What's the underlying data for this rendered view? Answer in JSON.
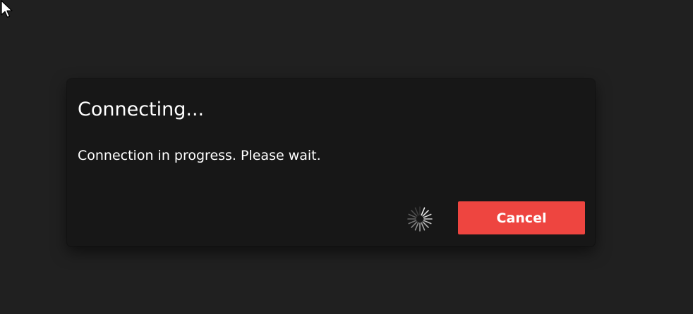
{
  "dialog": {
    "title": "Connecting...",
    "message": "Connection in progress. Please wait.",
    "cancel_label": "Cancel",
    "busy_indicator": "loading-spinner-icon"
  },
  "colors": {
    "screen_background": "#202020",
    "dialog_background": "#171717",
    "cancel_button": "#ee4540",
    "text": "#ffffff"
  }
}
